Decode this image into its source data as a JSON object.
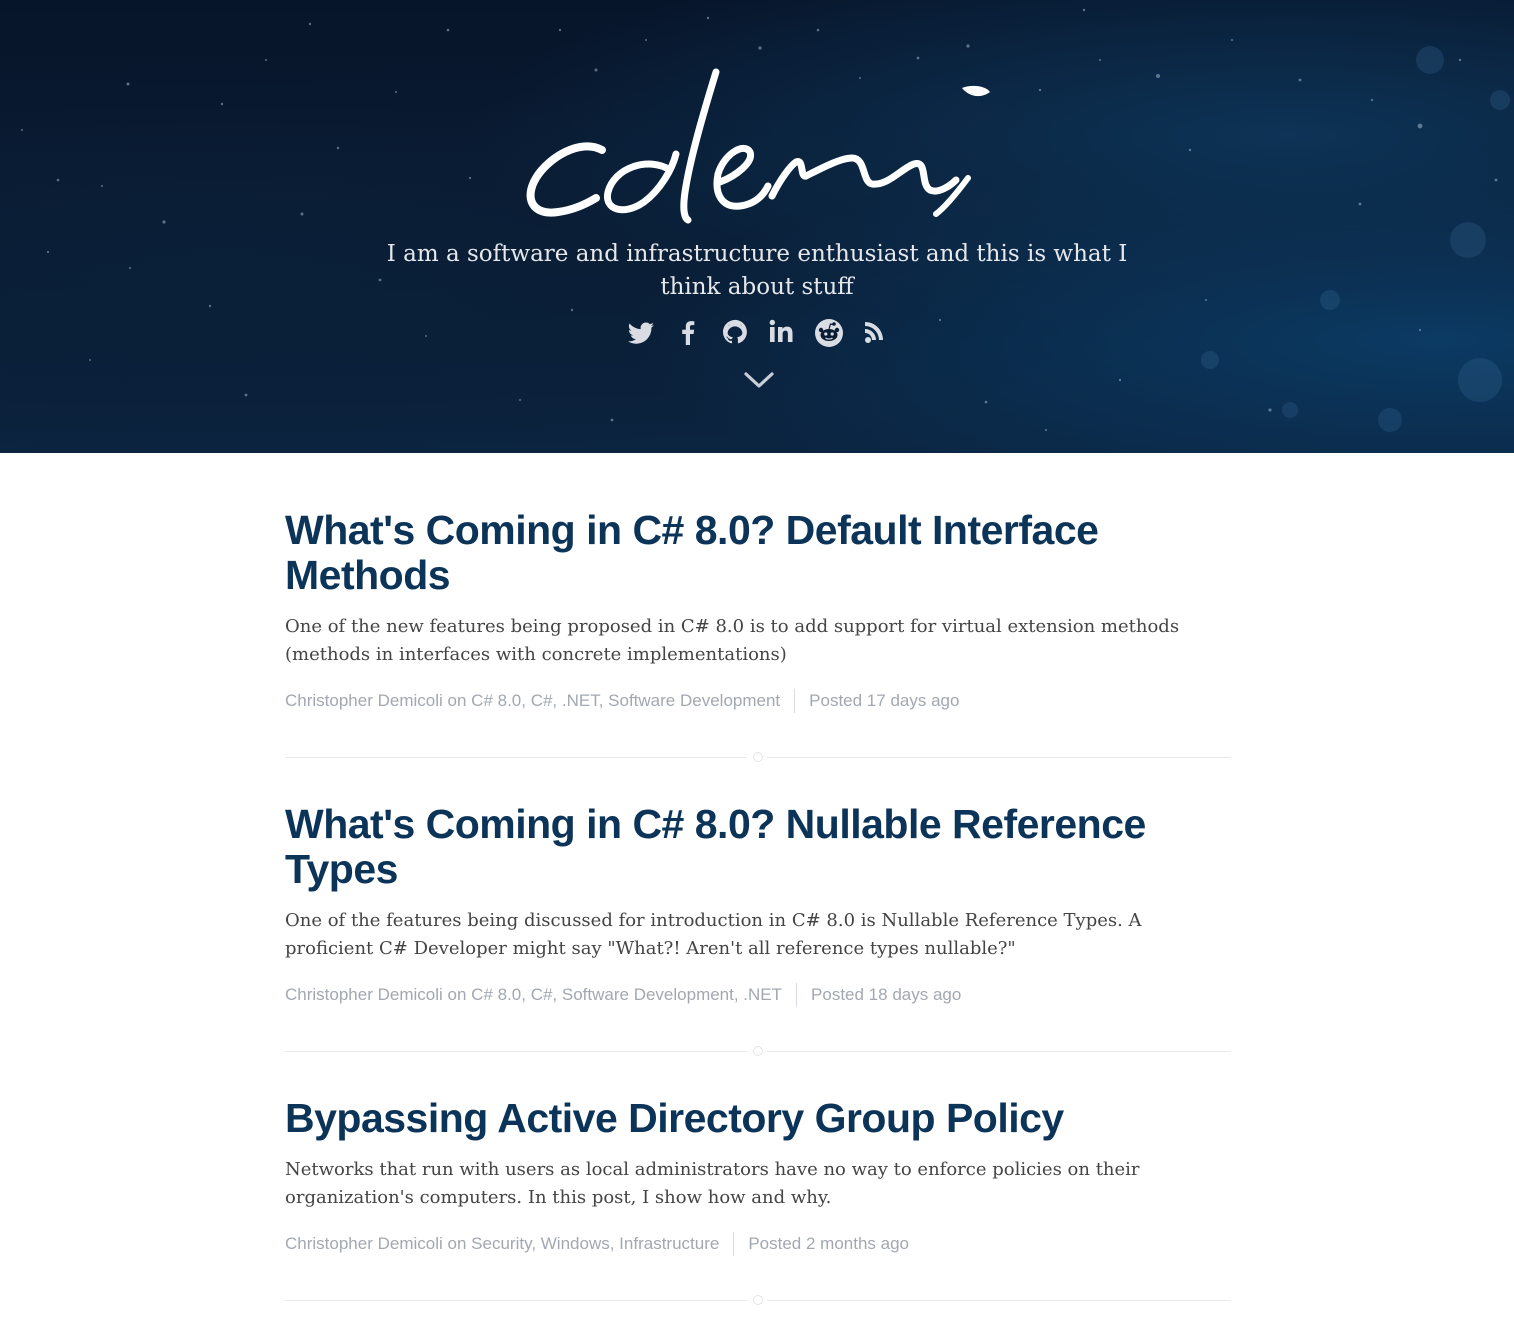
{
  "site": {
    "logo_text": "cdemi",
    "tagline": "I am a software and infrastructure enthusiast and this is what I think about stuff",
    "social_icons": [
      "twitter-icon",
      "facebook-icon",
      "github-icon",
      "linkedin-icon",
      "reddit-icon",
      "rss-icon"
    ],
    "scroll_icon": "chevron-down-icon"
  },
  "colors": {
    "hero_background": "#0a1c33",
    "title": "#0c3358",
    "meta": "#a2a8b1",
    "excerpt": "#444444"
  },
  "posts": [
    {
      "title": "What's Coming in C# 8.0? Default Interface Methods",
      "excerpt": "One of the new features being proposed in C# 8.0 is to add support for virtual extension methods (methods in interfaces with concrete implementations)",
      "author": "Christopher Demicoli",
      "on": "on",
      "tags": "C# 8.0, C#, .NET, Software Development",
      "posted": "Posted 17 days ago"
    },
    {
      "title": "What's Coming in C# 8.0? Nullable Reference Types",
      "excerpt": "One of the features being discussed for introduction in C# 8.0 is Nullable Reference Types. A proficient C# Developer might say \"What?! Aren't all reference types nullable?\"",
      "author": "Christopher Demicoli",
      "on": "on",
      "tags": "C# 8.0, C#, Software Development, .NET",
      "posted": "Posted 18 days ago"
    },
    {
      "title": "Bypassing Active Directory Group Policy",
      "excerpt": "Networks that run with users as local administrators have no way to enforce policies on their organization's computers. In this post, I show how and why.",
      "author": "Christopher Demicoli",
      "on": "on",
      "tags": "Security, Windows, Infrastructure",
      "posted": "Posted 2 months ago"
    }
  ]
}
